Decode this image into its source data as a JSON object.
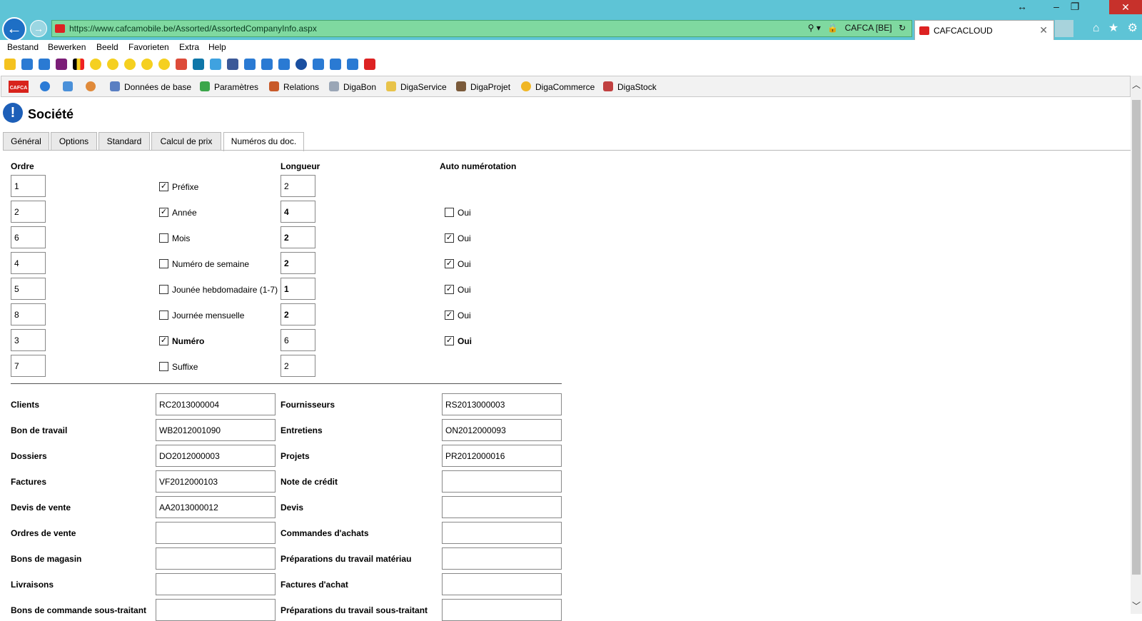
{
  "browser": {
    "url": "https://www.cafcamobile.be/Assorted/AssortedCompanyInfo.aspx",
    "site_identity": "CAFCA [BE]",
    "tab_title": "CAFCACLOUD"
  },
  "menu": [
    "Bestand",
    "Bewerken",
    "Beeld",
    "Favorieten",
    "Extra",
    "Help"
  ],
  "toolbar": {
    "logo_text": "CAFCA",
    "items": [
      "Données de base",
      "Paramètres",
      "Relations",
      "DigaBon",
      "DigaService",
      "DigaProjet",
      "DigaCommerce",
      "DigaStock"
    ]
  },
  "page": {
    "title": "Société",
    "tabs": [
      "Général",
      "Options",
      "Standard",
      "Calcul de prix",
      "Numéros du doc."
    ],
    "active_tab": "Numéros du doc."
  },
  "numbering": {
    "headers": {
      "order": "Ordre",
      "length": "Longueur",
      "auto": "Auto numérotation"
    },
    "rows": [
      {
        "order": "1",
        "checked": true,
        "label": "Préfixe",
        "length": "2",
        "auto": null,
        "bold": false
      },
      {
        "order": "2",
        "checked": true,
        "label": "Année",
        "length": "4",
        "auto": false,
        "bold": false
      },
      {
        "order": "6",
        "checked": false,
        "label": "Mois",
        "length": "2",
        "auto": true,
        "bold": false
      },
      {
        "order": "4",
        "checked": false,
        "label": "Numéro de semaine",
        "length": "2",
        "auto": true,
        "bold": false
      },
      {
        "order": "5",
        "checked": false,
        "label": "Jounée hebdomadaire (1-7)",
        "length": "1",
        "auto": true,
        "bold": false
      },
      {
        "order": "8",
        "checked": false,
        "label": "Journée mensuelle",
        "length": "2",
        "auto": true,
        "bold": false
      },
      {
        "order": "3",
        "checked": true,
        "label": "Numéro",
        "length": "6",
        "auto": true,
        "bold": true
      },
      {
        "order": "7",
        "checked": false,
        "label": "Suffixe",
        "length": "2",
        "auto": null,
        "bold": false
      }
    ],
    "auto_label": "Oui"
  },
  "documents": {
    "left": [
      {
        "label": "Clients",
        "value": "RC2013000004"
      },
      {
        "label": "Bon de travail",
        "value": "WB2012001090"
      },
      {
        "label": "Dossiers",
        "value": "DO2012000003"
      },
      {
        "label": "Factures",
        "value": "VF2012000103"
      },
      {
        "label": "Devis de vente",
        "value": "AA2013000012"
      },
      {
        "label": "Ordres de vente",
        "value": ""
      },
      {
        "label": "Bons de magasin",
        "value": ""
      },
      {
        "label": "Livraisons",
        "value": ""
      },
      {
        "label": "Bons de commande sous-traitant",
        "value": ""
      }
    ],
    "right": [
      {
        "label": "Fournisseurs",
        "value": "RS2013000003"
      },
      {
        "label": "Entretiens",
        "value": "ON2012000093"
      },
      {
        "label": "Projets",
        "value": "PR2012000016"
      },
      {
        "label": "Note de crédit",
        "value": ""
      },
      {
        "label": "Devis",
        "value": ""
      },
      {
        "label": "Commandes d'achats",
        "value": ""
      },
      {
        "label": "Préparations du travail matériau",
        "value": ""
      },
      {
        "label": "Factures d'achat",
        "value": ""
      },
      {
        "label": "Préparations du travail sous-traitant",
        "value": ""
      }
    ]
  },
  "colors": {
    "chrome": "#5ec4d6",
    "url_bar": "#7fd9a0",
    "accent_blue": "#1d5fb8",
    "close_red": "#c7312b"
  }
}
